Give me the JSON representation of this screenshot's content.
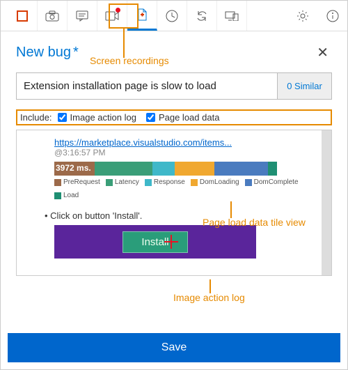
{
  "title": "New bug",
  "required_mark": "*",
  "bug_title_value": "Extension installation page is slow to load",
  "similar_label": "0 Similar",
  "include_label": "Include:",
  "include_options": {
    "image_action_log": "Image action log",
    "page_load_data": "Page load data"
  },
  "preview": {
    "link": "https://marketplace.visualstudio.com/items...",
    "timestamp": "@3:16:57 PM",
    "load_ms_label": "3972 ms.",
    "legend": [
      "PreRequest",
      "Latency",
      "Response",
      "DomLoading",
      "DomComplete",
      "Load"
    ],
    "step": "Click on button 'Install'.",
    "install_button_text": "Install"
  },
  "save_label": "Save",
  "annotations": {
    "screen_recordings": "Screen recordings",
    "page_load_tile": "Page load data tile view",
    "image_action_log": "Image action log"
  },
  "colors": {
    "prerequest": "#9c6a4a",
    "latency": "#3a9e78",
    "response": "#3fb8c9",
    "domloading": "#f0a830",
    "domcomplete": "#4a7bbf",
    "load": "#1f8f73"
  }
}
